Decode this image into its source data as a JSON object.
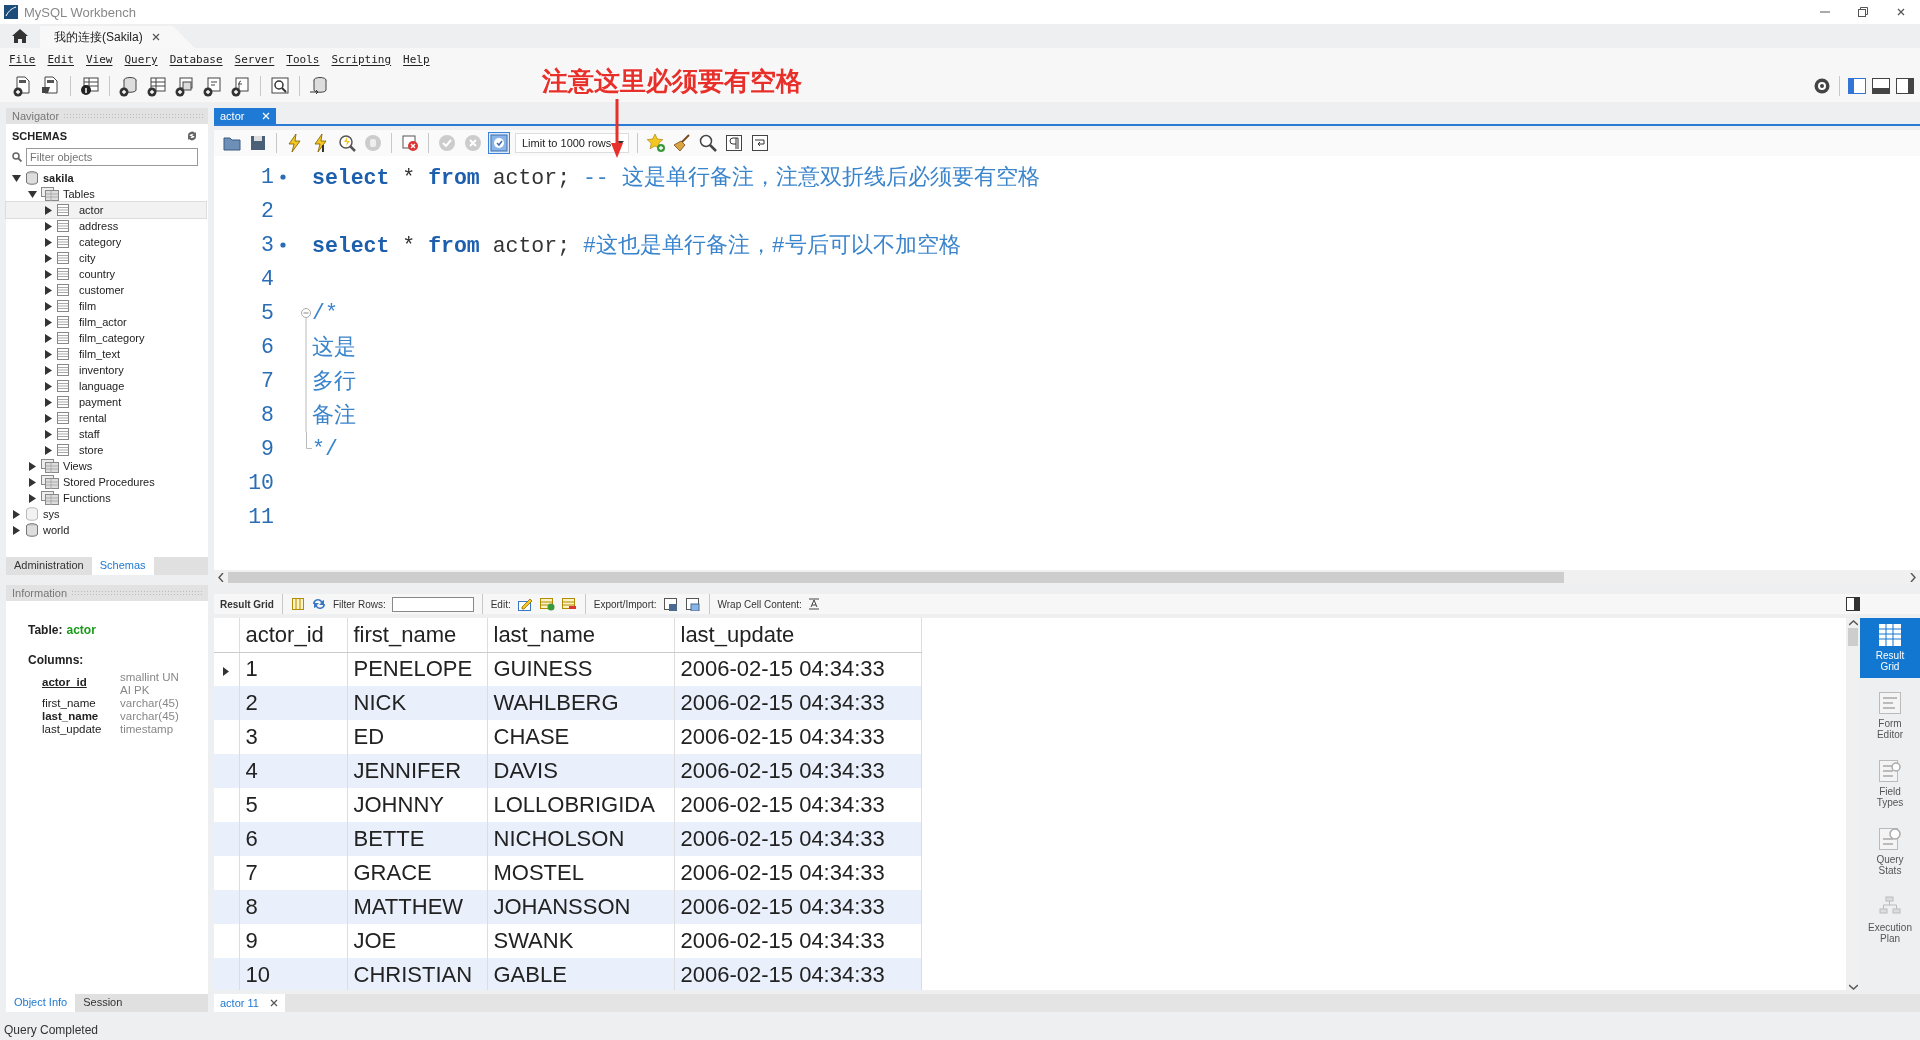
{
  "window": {
    "title": "MySQL Workbench"
  },
  "connection_tabs": [
    {
      "label": "我的连接(Sakila)",
      "selected": true
    }
  ],
  "menu": [
    "File",
    "Edit",
    "View",
    "Query",
    "Database",
    "Server",
    "Tools",
    "Scripting",
    "Help"
  ],
  "annotation": {
    "text": "注意这里必须要有空格"
  },
  "navigator": {
    "title": "Navigator",
    "section": "SCHEMAS",
    "filter": {
      "placeholder": "Filter objects"
    },
    "tree": [
      {
        "label": "sakila",
        "kind": "schema",
        "default": true,
        "dimmed": false,
        "expanded": true,
        "children": [
          {
            "label": "Tables",
            "kind": "folder",
            "expanded": true,
            "children": [
              {
                "label": "actor",
                "kind": "table",
                "expanded": false,
                "selected": true
              },
              {
                "label": "address",
                "kind": "table",
                "expanded": false,
                "selected": false
              },
              {
                "label": "category",
                "kind": "table",
                "expanded": false,
                "selected": false
              },
              {
                "label": "city",
                "kind": "table",
                "expanded": false,
                "selected": false
              },
              {
                "label": "country",
                "kind": "table",
                "expanded": false,
                "selected": false
              },
              {
                "label": "customer",
                "kind": "table",
                "expanded": false,
                "selected": false
              },
              {
                "label": "film",
                "kind": "table",
                "expanded": false,
                "selected": false
              },
              {
                "label": "film_actor",
                "kind": "table",
                "expanded": false,
                "selected": false
              },
              {
                "label": "film_category",
                "kind": "table",
                "expanded": false,
                "selected": false
              },
              {
                "label": "film_text",
                "kind": "table",
                "expanded": false,
                "selected": false
              },
              {
                "label": "inventory",
                "kind": "table",
                "expanded": false,
                "selected": false
              },
              {
                "label": "language",
                "kind": "table",
                "expanded": false,
                "selected": false
              },
              {
                "label": "payment",
                "kind": "table",
                "expanded": false,
                "selected": false
              },
              {
                "label": "rental",
                "kind": "table",
                "expanded": false,
                "selected": false
              },
              {
                "label": "staff",
                "kind": "table",
                "expanded": false,
                "selected": false
              },
              {
                "label": "store",
                "kind": "table",
                "expanded": false,
                "selected": false
              }
            ]
          },
          {
            "label": "Views",
            "kind": "folder",
            "expanded": false
          },
          {
            "label": "Stored Procedures",
            "kind": "folder",
            "expanded": false
          },
          {
            "label": "Functions",
            "kind": "folder",
            "expanded": false
          }
        ]
      },
      {
        "label": "sys",
        "kind": "schema",
        "default": false,
        "dimmed": true,
        "expanded": false
      },
      {
        "label": "world",
        "kind": "schema",
        "default": false,
        "dimmed": false,
        "expanded": false
      }
    ],
    "tabs": [
      {
        "label": "Administration",
        "selected": false
      },
      {
        "label": "Schemas",
        "selected": true
      }
    ]
  },
  "information": {
    "title": "Information",
    "table_label": "Table:",
    "table_name": "actor",
    "columns_label": "Columns:",
    "columns": [
      {
        "name": "actor_id",
        "type": "smallint UN AI PK",
        "kind": "primary"
      },
      {
        "name": "first_name",
        "type": "varchar(45)",
        "kind": "plain"
      },
      {
        "name": "last_name",
        "type": "varchar(45)",
        "kind": "indexed"
      },
      {
        "name": "last_update",
        "type": "timestamp",
        "kind": "plain"
      }
    ],
    "tabs": [
      {
        "label": "Object Info",
        "selected": true
      },
      {
        "label": "Session",
        "selected": false
      }
    ]
  },
  "editor": {
    "tabs": [
      {
        "label": "actor",
        "selected": true
      }
    ],
    "limit": "Limit to 1000 rows",
    "lines": [
      {
        "number": "1",
        "statement": true,
        "kind": "code",
        "tokens": [
          {
            "kind": "keyword",
            "text": "select"
          },
          {
            "kind": "plain",
            "text": " * "
          },
          {
            "kind": "keyword",
            "text": "from"
          },
          {
            "kind": "plain",
            "text": " actor; "
          },
          {
            "kind": "comment",
            "text": "-- 这是单行备注，注意双折线后必须要有空格"
          }
        ]
      },
      {
        "number": "2",
        "statement": false,
        "kind": "code"
      },
      {
        "number": "3",
        "statement": true,
        "kind": "code",
        "tokens": [
          {
            "kind": "keyword",
            "text": "select"
          },
          {
            "kind": "plain",
            "text": " * "
          },
          {
            "kind": "keyword",
            "text": "from"
          },
          {
            "kind": "plain",
            "text": " actor; "
          },
          {
            "kind": "comment",
            "text": "#这也是单行备注，#号后可以不加空格"
          }
        ]
      },
      {
        "number": "4",
        "statement": false,
        "kind": "code"
      },
      {
        "number": "5",
        "statement": false,
        "kind": "fold-start",
        "tokens": [
          {
            "kind": "comment",
            "text": "/*"
          }
        ]
      },
      {
        "number": "6",
        "statement": false,
        "kind": "fold-body",
        "tokens": [
          {
            "kind": "comment",
            "text": "这是"
          }
        ]
      },
      {
        "number": "7",
        "statement": false,
        "kind": "fold-body",
        "tokens": [
          {
            "kind": "comment",
            "text": "多行"
          }
        ]
      },
      {
        "number": "8",
        "statement": false,
        "kind": "fold-body",
        "tokens": [
          {
            "kind": "comment",
            "text": "备注"
          }
        ]
      },
      {
        "number": "9",
        "statement": false,
        "kind": "fold-end",
        "tokens": [
          {
            "kind": "comment",
            "text": "*/"
          }
        ]
      },
      {
        "number": "10",
        "statement": false,
        "kind": "code"
      },
      {
        "number": "11",
        "statement": false,
        "kind": "code"
      }
    ]
  },
  "results": {
    "toolbar": {
      "view_label": "Result Grid",
      "filter_label": "Filter Rows:",
      "edit_label": "Edit:",
      "export_label": "Export/Import:",
      "wrap_label": "Wrap Cell Content:"
    },
    "columns": [
      "actor_id",
      "first_name",
      "last_name",
      "last_update"
    ],
    "rows": [
      {
        "current": true,
        "cells": [
          "1",
          "PENELOPE",
          "GUINESS",
          "2006-02-15 04:34:33"
        ]
      },
      {
        "current": false,
        "cells": [
          "2",
          "NICK",
          "WAHLBERG",
          "2006-02-15 04:34:33"
        ]
      },
      {
        "current": false,
        "cells": [
          "3",
          "ED",
          "CHASE",
          "2006-02-15 04:34:33"
        ]
      },
      {
        "current": false,
        "cells": [
          "4",
          "JENNIFER",
          "DAVIS",
          "2006-02-15 04:34:33"
        ]
      },
      {
        "current": false,
        "cells": [
          "5",
          "JOHNNY",
          "LOLLOBRIGIDA",
          "2006-02-15 04:34:33"
        ]
      },
      {
        "current": false,
        "cells": [
          "6",
          "BETTE",
          "NICHOLSON",
          "2006-02-15 04:34:33"
        ]
      },
      {
        "current": false,
        "cells": [
          "7",
          "GRACE",
          "MOSTEL",
          "2006-02-15 04:34:33"
        ]
      },
      {
        "current": false,
        "cells": [
          "8",
          "MATTHEW",
          "JOHANSSON",
          "2006-02-15 04:34:33"
        ]
      },
      {
        "current": false,
        "cells": [
          "9",
          "JOE",
          "SWANK",
          "2006-02-15 04:34:33"
        ]
      },
      {
        "current": false,
        "cells": [
          "10",
          "CHRISTIAN",
          "GABLE",
          "2006-02-15 04:34:33"
        ]
      }
    ]
  },
  "side_panel": [
    {
      "label": "Result Grid",
      "selected": true
    },
    {
      "label": "Form Editor",
      "selected": false
    },
    {
      "label": "Field Types",
      "selected": false
    },
    {
      "label": "Query Stats",
      "selected": false
    },
    {
      "label": "Execution Plan",
      "selected": false
    }
  ],
  "output_tabs": [
    {
      "label": "actor 11",
      "selected": true
    }
  ],
  "status_bar": "Query Completed"
}
